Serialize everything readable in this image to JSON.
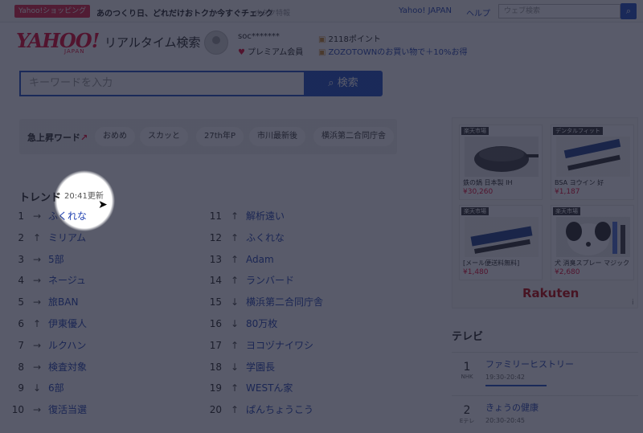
{
  "topbar": {
    "shop_badge": "Yahoo!ショッピング",
    "promo": "あのつくり日、どれだけおトクか今すぐチェック",
    "promo_sub": "オタク特報",
    "yahoo_japan": "Yahoo! JAPAN",
    "help": "ヘルプ",
    "search_placeholder": "ウェブ検索"
  },
  "header": {
    "logo": "YAHOO!",
    "logo_sub": "JAPAN",
    "title": "リアルタイム検索",
    "user_name": "soc*******",
    "member": "プレミアム会員",
    "points": "2118ポイント",
    "zozo": "ZOZOTOWNのお買い物で＋10%お得"
  },
  "search": {
    "placeholder": "キーワードを入力",
    "button": "検索"
  },
  "wordbar": {
    "label": "急上昇ワード",
    "chips": [
      "おめめ",
      "スカッと",
      "27th年P",
      "市川最新後",
      "横浜第二合同庁舎"
    ]
  },
  "trend": {
    "heading": "トレンド",
    "updated": "20:41更新",
    "left": [
      {
        "rank": "1",
        "arrow": "→",
        "keyword": "ふくれな"
      },
      {
        "rank": "2",
        "arrow": "↑",
        "keyword": "ミリアム"
      },
      {
        "rank": "3",
        "arrow": "→",
        "keyword": "5部"
      },
      {
        "rank": "4",
        "arrow": "→",
        "keyword": "ネージュ"
      },
      {
        "rank": "5",
        "arrow": "→",
        "keyword": "旅BAN"
      },
      {
        "rank": "6",
        "arrow": "↑",
        "keyword": "伊東優人"
      },
      {
        "rank": "7",
        "arrow": "→",
        "keyword": "ルクハン"
      },
      {
        "rank": "8",
        "arrow": "→",
        "keyword": "検査対象"
      },
      {
        "rank": "9",
        "arrow": "↓",
        "keyword": "6部"
      },
      {
        "rank": "10",
        "arrow": "→",
        "keyword": "復活当選"
      }
    ],
    "right": [
      {
        "rank": "11",
        "arrow": "↑",
        "keyword": "解析遠い"
      },
      {
        "rank": "12",
        "arrow": "↑",
        "keyword": "ふくれな"
      },
      {
        "rank": "13",
        "arrow": "↑",
        "keyword": "Adam"
      },
      {
        "rank": "14",
        "arrow": "↑",
        "keyword": "ランバード"
      },
      {
        "rank": "15",
        "arrow": "↓",
        "keyword": "横浜第二合同庁舎"
      },
      {
        "rank": "16",
        "arrow": "↓",
        "keyword": "80万枚"
      },
      {
        "rank": "17",
        "arrow": "↑",
        "keyword": "ヨコヅナイワシ"
      },
      {
        "rank": "18",
        "arrow": "↓",
        "keyword": "学園長"
      },
      {
        "rank": "19",
        "arrow": "↑",
        "keyword": "WESTん家"
      },
      {
        "rank": "20",
        "arrow": "↑",
        "keyword": "ぱんちょうこう"
      }
    ]
  },
  "ad": {
    "items": [
      {
        "tag": "楽天市場",
        "title": "鉄の鍋 日本製 IH",
        "price": "¥30,260"
      },
      {
        "tag": "デンタルフィット",
        "title": "BSA ヨウイン 好",
        "price": "¥1,187"
      },
      {
        "tag": "楽天市場",
        "title": "[メール便送料無料]",
        "price": "¥1,480"
      },
      {
        "tag": "楽天市場",
        "title": "犬 消臭スプレー マジック",
        "price": "¥2,680"
      }
    ],
    "logo": "Rakuten",
    "mark": "i"
  },
  "tv": {
    "heading": "テレビ",
    "rows": [
      {
        "ch": "1",
        "net": "NHK",
        "title": "ファミリーヒストリー",
        "time": "19:30-20:42"
      },
      {
        "ch": "2",
        "net": "Eテレ",
        "title": "きょうの健康",
        "time": "20:30-20:45"
      }
    ]
  },
  "colors": {
    "accent": "#1b4cc4",
    "brand": "#e4002b",
    "link": "#1e3fb0"
  }
}
